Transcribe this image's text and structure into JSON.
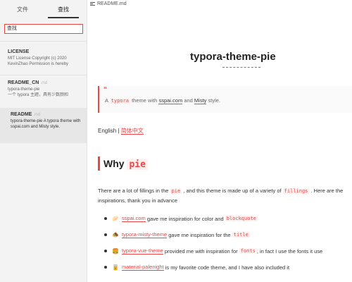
{
  "sidebar": {
    "tabs": {
      "files": "文件",
      "search": "查找"
    },
    "search_value": "查找",
    "results": [
      {
        "title": "LICENSE",
        "ext": "",
        "snippet1": "MIT License Copyright (c) 2020",
        "snippet2": "KevinZhao Permission is hereby"
      },
      {
        "title": "README_CN",
        "ext": ".md",
        "snippet1": "typora-theme-pie",
        "snippet2": "一个 typora 主题，具有少数颜和"
      },
      {
        "title": "README",
        "ext": ".md",
        "snippet1": "typora-theme-pie A typora theme with sspai.com and Misty style."
      }
    ]
  },
  "header": {
    "filename": "README.md"
  },
  "doc": {
    "title": "typora-theme-pie",
    "quote": {
      "mark": "“",
      "a": "A",
      "typora": "typora",
      "mid1": "theme with",
      "sspai": "sspai.com",
      "and": "and",
      "misty": "Misty",
      "end": "style."
    },
    "lang": {
      "english": "English",
      "sep": "|",
      "chinese": "简体中文"
    },
    "why": {
      "word": "Why",
      "pie": "pie"
    },
    "para": {
      "p1": "There are a lot of fillings in the",
      "code1": "pie",
      "p2": ", and this theme is made up of a variety of",
      "code2": "fillings",
      "p3": ". Here are the",
      "line2": "inspirations, thank you in advance"
    },
    "items": [
      {
        "emoji": "🥟",
        "link": "sspai.com",
        "text": "gave me inspiration for color and",
        "code": "blockquote",
        "tail": ""
      },
      {
        "emoji": "🧆",
        "link": "typora-misty-theme",
        "text": "gave me inspiration for the",
        "code": "title",
        "tail": ""
      },
      {
        "emoji": "🍔",
        "link": "typora-vue-theme",
        "text": "provided me with inspiration for",
        "code": "fonts",
        "tail": ", in fact I use the fonts it use"
      },
      {
        "emoji": "🥫",
        "link": "material-palenight",
        "text": "is my favorite code theme, and I have also included it",
        "code": "",
        "tail": ""
      }
    ]
  }
}
